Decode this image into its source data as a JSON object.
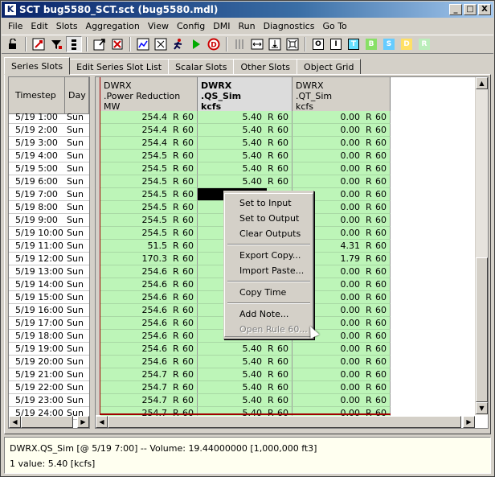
{
  "window": {
    "title": "SCT bug5580_SCT.sct (bug5580.mdl)",
    "min": "_",
    "max": "□",
    "close": "X"
  },
  "menubar": [
    "File",
    "Edit",
    "Slots",
    "Aggregation",
    "View",
    "Config",
    "DMI",
    "Run",
    "Diagnostics",
    "Go To"
  ],
  "toolbar": {
    "letters": [
      "O",
      "I",
      "T",
      "B",
      "S",
      "D",
      "R"
    ],
    "letter_colors": [
      "#ffffff",
      "#ffffff",
      "#66e0ff",
      "#88e066",
      "#66ccff",
      "#ffe066",
      "#88dd88"
    ]
  },
  "tabs": [
    "Series Slots",
    "Edit Series Slot List",
    "Scalar Slots",
    "Other Slots",
    "Object Grid"
  ],
  "left_headers": {
    "timestep": "Timestep",
    "day": "Day"
  },
  "columns": [
    {
      "l1": "DWRX",
      "l2": ".Power Reduction",
      "l3": "MW",
      "bold": false
    },
    {
      "l1": "DWRX",
      "l2": ".QS_Sim",
      "l3": "kcfs",
      "bold": true
    },
    {
      "l1": "DWRX",
      "l2": ".QT_Sim",
      "l3": "kcfs",
      "bold": false
    }
  ],
  "rows": [
    {
      "ts": "5/19 1:00",
      "day": "Sun",
      "pr": "254.4",
      "qs": "5.40",
      "qt": "0.00"
    },
    {
      "ts": "5/19 2:00",
      "day": "Sun",
      "pr": "254.4",
      "qs": "5.40",
      "qt": "0.00"
    },
    {
      "ts": "5/19 3:00",
      "day": "Sun",
      "pr": "254.4",
      "qs": "5.40",
      "qt": "0.00"
    },
    {
      "ts": "5/19 4:00",
      "day": "Sun",
      "pr": "254.5",
      "qs": "5.40",
      "qt": "0.00"
    },
    {
      "ts": "5/19 5:00",
      "day": "Sun",
      "pr": "254.5",
      "qs": "5.40",
      "qt": "0.00"
    },
    {
      "ts": "5/19 6:00",
      "day": "Sun",
      "pr": "254.5",
      "qs": "5.40",
      "qt": "0.00"
    },
    {
      "ts": "5/19 7:00",
      "day": "Sun",
      "pr": "254.5",
      "qs": "5.40",
      "qt": "0.00"
    },
    {
      "ts": "5/19 8:00",
      "day": "Sun",
      "pr": "254.5",
      "qs": "",
      "qt": "0.00"
    },
    {
      "ts": "5/19 9:00",
      "day": "Sun",
      "pr": "254.5",
      "qs": "",
      "qt": "0.00"
    },
    {
      "ts": "5/19 10:00",
      "day": "Sun",
      "pr": "254.5",
      "qs": "",
      "qt": "0.00"
    },
    {
      "ts": "5/19 11:00",
      "day": "Sun",
      "pr": "51.5",
      "qs": "",
      "qt": "4.31"
    },
    {
      "ts": "5/19 12:00",
      "day": "Sun",
      "pr": "170.3",
      "qs": "",
      "qt": "1.79"
    },
    {
      "ts": "5/19 13:00",
      "day": "Sun",
      "pr": "254.6",
      "qs": "",
      "qt": "0.00"
    },
    {
      "ts": "5/19 14:00",
      "day": "Sun",
      "pr": "254.6",
      "qs": "",
      "qt": "0.00"
    },
    {
      "ts": "5/19 15:00",
      "day": "Sun",
      "pr": "254.6",
      "qs": "",
      "qt": "0.00"
    },
    {
      "ts": "5/19 16:00",
      "day": "Sun",
      "pr": "254.6",
      "qs": "",
      "qt": "0.00"
    },
    {
      "ts": "5/19 17:00",
      "day": "Sun",
      "pr": "254.6",
      "qs": "",
      "qt": "0.00"
    },
    {
      "ts": "5/19 18:00",
      "day": "Sun",
      "pr": "254.6",
      "qs": "",
      "qt": "0.00"
    },
    {
      "ts": "5/19 19:00",
      "day": "Sun",
      "pr": "254.6",
      "qs": "5.40",
      "qt": "0.00"
    },
    {
      "ts": "5/19 20:00",
      "day": "Sun",
      "pr": "254.6",
      "qs": "5.40",
      "qt": "0.00"
    },
    {
      "ts": "5/19 21:00",
      "day": "Sun",
      "pr": "254.7",
      "qs": "5.40",
      "qt": "0.00"
    },
    {
      "ts": "5/19 22:00",
      "day": "Sun",
      "pr": "254.7",
      "qs": "5.40",
      "qt": "0.00"
    },
    {
      "ts": "5/19 23:00",
      "day": "Sun",
      "pr": "254.7",
      "qs": "5.40",
      "qt": "0.00"
    },
    {
      "ts": "5/19 24:00",
      "day": "Sun",
      "pr": "254.7",
      "qs": "5.40",
      "qt": "0.00"
    }
  ],
  "flag_r": "R",
  "flag_60": "60",
  "context_menu": {
    "group1": [
      "Set to Input",
      "Set to Output",
      "Clear Outputs"
    ],
    "group2": [
      "Export Copy...",
      "Import Paste..."
    ],
    "group3": [
      "Copy Time"
    ],
    "group4": [
      "Add Note..."
    ],
    "disabled": "Open Rule 60..."
  },
  "status": {
    "line1": "DWRX.QS_Sim [@ 5/19 7:00] -- Volume: 19.44000000 [1,000,000 ft3]",
    "line2": "1 value:  5.40 [kcfs]"
  },
  "colors": {
    "green": "#bdf5b8",
    "selected": "#000000",
    "bar": "#a00000"
  }
}
